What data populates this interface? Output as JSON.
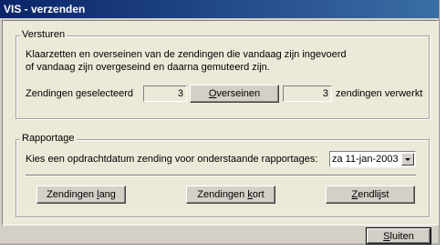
{
  "window": {
    "title": "VIS - verzenden"
  },
  "versturen": {
    "legend": "Versturen",
    "description_line1": "Klaarzetten en overseinen van de zendingen die vandaag zijn ingevoerd",
    "description_line2": "of vandaag zijn overgeseind en daarna gemuteerd zijn.",
    "selected_label": "Zendingen geselecteerd",
    "selected_count": "3",
    "overseinen_prefix": "",
    "overseinen_hotkey": "O",
    "overseinen_rest": "verseinen",
    "processed_count": "3",
    "processed_label": "zendingen verwerkt"
  },
  "rapportage": {
    "legend": "Rapportage",
    "prompt": "Kies een opdrachtdatum zending voor onderstaande rapportages:",
    "date_value": "za 11-jan-2003",
    "btn_lang_prefix": "Zendingen ",
    "btn_lang_hotkey": "l",
    "btn_lang_rest": "ang",
    "btn_kort_prefix": "Zendingen ",
    "btn_kort_hotkey": "k",
    "btn_kort_rest": "ort",
    "btn_zendlijst_prefix": "",
    "btn_zendlijst_hotkey": "Z",
    "btn_zendlijst_rest": "endlijst"
  },
  "footer": {
    "close_prefix": "",
    "close_hotkey": "S",
    "close_rest": "luiten"
  }
}
